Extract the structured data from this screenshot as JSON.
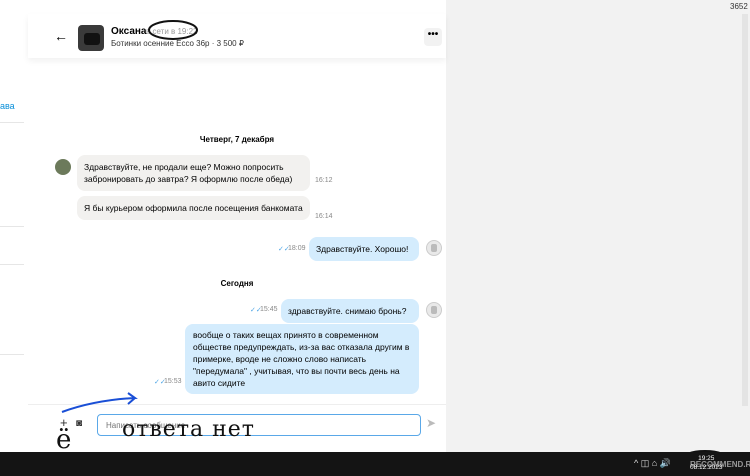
{
  "corner": {
    "counter": "3652"
  },
  "left_panel": {
    "link_text": "ава"
  },
  "header": {
    "back_icon": "←",
    "name": "Оксана",
    "last_seen": "в сети в 19:22",
    "listing": "Ботинки осенние Ecco 36р · 3 500 ₽",
    "menu_icon": "•••"
  },
  "messages": {
    "day1_label": "Четверг, 7 декабря",
    "m1": {
      "text": "Здравствуйте, не продали еще? Можно попросить забронировать до завтра? Я оформлю после обеда)",
      "time": "16:12"
    },
    "m2": {
      "text": "Я бы курьером оформила после посещения банкомата",
      "time": "16:14"
    },
    "m3": {
      "text": "Здравствуйте. Хорошо!",
      "time": "18:09",
      "ticks": "✓✓"
    },
    "day2_label": "Сегодня",
    "m4": {
      "text": "здравствуйте. снимаю бронь?",
      "time": "15:45",
      "ticks": "✓✓"
    },
    "m5": {
      "text": "вообще о таких вещах принято в современном обществе предупреждать, из-за вас отказала другим в примерке, вроде не сложно слово написать \"передумала\" , учитывая, что вы почти весь день на авито сидите",
      "time": "15:53",
      "ticks": "✓✓"
    }
  },
  "composer": {
    "plus_icon": "+",
    "camera_icon": "◙",
    "placeholder": "Написать сообщение",
    "send_icon": "➤"
  },
  "handwriting": "ответа нет",
  "taskbar": {
    "clock_time": "19:25",
    "clock_date": "08.12.2023",
    "tray_icons": "^ ◫ ⌂ 🔊",
    "watermark": "RECOMMEND.RU"
  }
}
